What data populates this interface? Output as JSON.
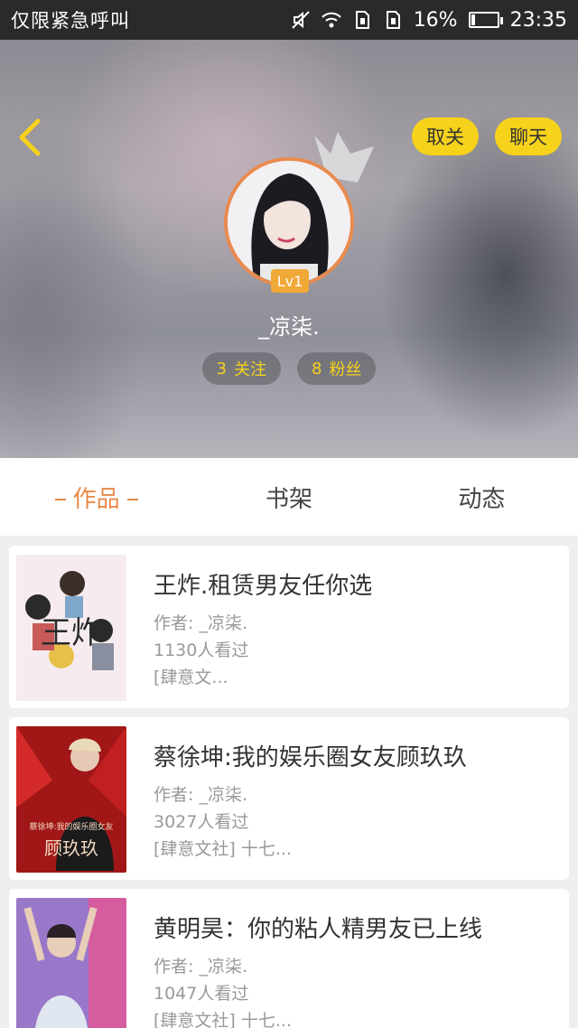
{
  "status_bar": {
    "carrier": "仅限紧急呼叫",
    "battery_pct": "16%",
    "battery_level": 0.16,
    "time": "23:35"
  },
  "header": {
    "back_icon": "chevron-left-icon",
    "unfollow_label": "取关",
    "chat_label": "聊天",
    "level": "Lv1",
    "username": "_凉柒.",
    "following_count": "3",
    "following_label": "关注",
    "fans_count": "8",
    "fans_label": "粉丝",
    "accent": "#f6d21a"
  },
  "tabs": [
    {
      "label": "作品",
      "active": true
    },
    {
      "label": "书架",
      "active": false
    },
    {
      "label": "动态",
      "active": false
    }
  ],
  "works": [
    {
      "title": "王炸.租赁男友任你选",
      "author": "作者: _凉柒.",
      "views": "1130人看过",
      "desc": "[肆意文..."
    },
    {
      "title": "蔡徐坤:我的娱乐圈女友顾玖玖",
      "author": "作者: _凉柒.",
      "views": "3027人看过",
      "desc": "[肆意文社] 十七..."
    },
    {
      "title": "黄明昊：你的粘人精男友已上线",
      "author": "作者: _凉柒.",
      "views": "1047人看过",
      "desc": "[肆意文社] 十七..."
    }
  ],
  "covers": [
    {
      "text": "王炸"
    },
    {
      "text": "蔡徐坤:我的娱乐圈女友",
      "text2": "顾玖玖"
    },
    {
      "text": ""
    }
  ],
  "colors": {
    "tab_active": "#e8894a",
    "avatar_ring": "#e98a4e"
  }
}
